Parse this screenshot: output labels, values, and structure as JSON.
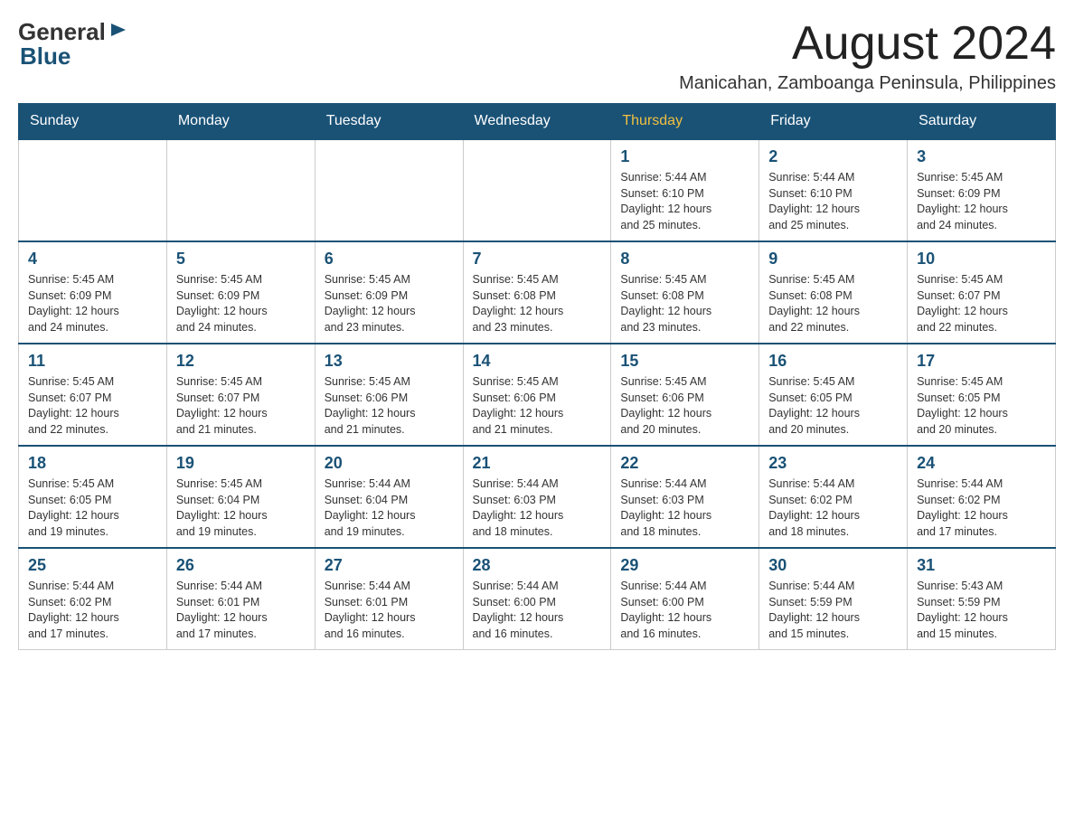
{
  "header": {
    "logo": {
      "general": "General",
      "blue": "Blue"
    },
    "month_title": "August 2024",
    "location": "Manicahan, Zamboanga Peninsula, Philippines"
  },
  "days_of_week": [
    "Sunday",
    "Monday",
    "Tuesday",
    "Wednesday",
    "Thursday",
    "Friday",
    "Saturday"
  ],
  "weeks": [
    {
      "days": [
        {
          "date": "",
          "info": ""
        },
        {
          "date": "",
          "info": ""
        },
        {
          "date": "",
          "info": ""
        },
        {
          "date": "",
          "info": ""
        },
        {
          "date": "1",
          "info": "Sunrise: 5:44 AM\nSunset: 6:10 PM\nDaylight: 12 hours\nand 25 minutes."
        },
        {
          "date": "2",
          "info": "Sunrise: 5:44 AM\nSunset: 6:10 PM\nDaylight: 12 hours\nand 25 minutes."
        },
        {
          "date": "3",
          "info": "Sunrise: 5:45 AM\nSunset: 6:09 PM\nDaylight: 12 hours\nand 24 minutes."
        }
      ]
    },
    {
      "days": [
        {
          "date": "4",
          "info": "Sunrise: 5:45 AM\nSunset: 6:09 PM\nDaylight: 12 hours\nand 24 minutes."
        },
        {
          "date": "5",
          "info": "Sunrise: 5:45 AM\nSunset: 6:09 PM\nDaylight: 12 hours\nand 24 minutes."
        },
        {
          "date": "6",
          "info": "Sunrise: 5:45 AM\nSunset: 6:09 PM\nDaylight: 12 hours\nand 23 minutes."
        },
        {
          "date": "7",
          "info": "Sunrise: 5:45 AM\nSunset: 6:08 PM\nDaylight: 12 hours\nand 23 minutes."
        },
        {
          "date": "8",
          "info": "Sunrise: 5:45 AM\nSunset: 6:08 PM\nDaylight: 12 hours\nand 23 minutes."
        },
        {
          "date": "9",
          "info": "Sunrise: 5:45 AM\nSunset: 6:08 PM\nDaylight: 12 hours\nand 22 minutes."
        },
        {
          "date": "10",
          "info": "Sunrise: 5:45 AM\nSunset: 6:07 PM\nDaylight: 12 hours\nand 22 minutes."
        }
      ]
    },
    {
      "days": [
        {
          "date": "11",
          "info": "Sunrise: 5:45 AM\nSunset: 6:07 PM\nDaylight: 12 hours\nand 22 minutes."
        },
        {
          "date": "12",
          "info": "Sunrise: 5:45 AM\nSunset: 6:07 PM\nDaylight: 12 hours\nand 21 minutes."
        },
        {
          "date": "13",
          "info": "Sunrise: 5:45 AM\nSunset: 6:06 PM\nDaylight: 12 hours\nand 21 minutes."
        },
        {
          "date": "14",
          "info": "Sunrise: 5:45 AM\nSunset: 6:06 PM\nDaylight: 12 hours\nand 21 minutes."
        },
        {
          "date": "15",
          "info": "Sunrise: 5:45 AM\nSunset: 6:06 PM\nDaylight: 12 hours\nand 20 minutes."
        },
        {
          "date": "16",
          "info": "Sunrise: 5:45 AM\nSunset: 6:05 PM\nDaylight: 12 hours\nand 20 minutes."
        },
        {
          "date": "17",
          "info": "Sunrise: 5:45 AM\nSunset: 6:05 PM\nDaylight: 12 hours\nand 20 minutes."
        }
      ]
    },
    {
      "days": [
        {
          "date": "18",
          "info": "Sunrise: 5:45 AM\nSunset: 6:05 PM\nDaylight: 12 hours\nand 19 minutes."
        },
        {
          "date": "19",
          "info": "Sunrise: 5:45 AM\nSunset: 6:04 PM\nDaylight: 12 hours\nand 19 minutes."
        },
        {
          "date": "20",
          "info": "Sunrise: 5:44 AM\nSunset: 6:04 PM\nDaylight: 12 hours\nand 19 minutes."
        },
        {
          "date": "21",
          "info": "Sunrise: 5:44 AM\nSunset: 6:03 PM\nDaylight: 12 hours\nand 18 minutes."
        },
        {
          "date": "22",
          "info": "Sunrise: 5:44 AM\nSunset: 6:03 PM\nDaylight: 12 hours\nand 18 minutes."
        },
        {
          "date": "23",
          "info": "Sunrise: 5:44 AM\nSunset: 6:02 PM\nDaylight: 12 hours\nand 18 minutes."
        },
        {
          "date": "24",
          "info": "Sunrise: 5:44 AM\nSunset: 6:02 PM\nDaylight: 12 hours\nand 17 minutes."
        }
      ]
    },
    {
      "days": [
        {
          "date": "25",
          "info": "Sunrise: 5:44 AM\nSunset: 6:02 PM\nDaylight: 12 hours\nand 17 minutes."
        },
        {
          "date": "26",
          "info": "Sunrise: 5:44 AM\nSunset: 6:01 PM\nDaylight: 12 hours\nand 17 minutes."
        },
        {
          "date": "27",
          "info": "Sunrise: 5:44 AM\nSunset: 6:01 PM\nDaylight: 12 hours\nand 16 minutes."
        },
        {
          "date": "28",
          "info": "Sunrise: 5:44 AM\nSunset: 6:00 PM\nDaylight: 12 hours\nand 16 minutes."
        },
        {
          "date": "29",
          "info": "Sunrise: 5:44 AM\nSunset: 6:00 PM\nDaylight: 12 hours\nand 16 minutes."
        },
        {
          "date": "30",
          "info": "Sunrise: 5:44 AM\nSunset: 5:59 PM\nDaylight: 12 hours\nand 15 minutes."
        },
        {
          "date": "31",
          "info": "Sunrise: 5:43 AM\nSunset: 5:59 PM\nDaylight: 12 hours\nand 15 minutes."
        }
      ]
    }
  ]
}
